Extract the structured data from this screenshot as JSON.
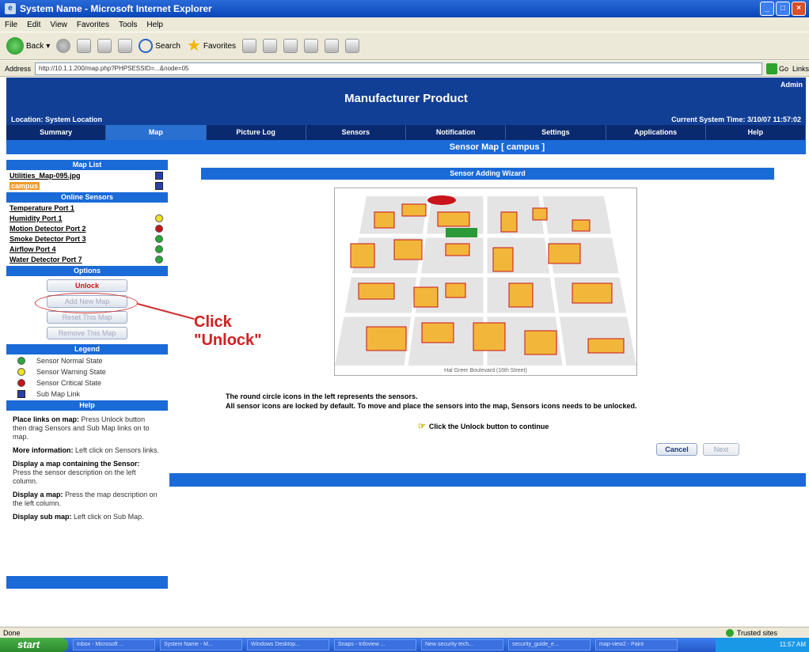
{
  "window": {
    "title": "System Name - Microsoft Internet Explorer"
  },
  "menu": [
    "File",
    "Edit",
    "View",
    "Favorites",
    "Tools",
    "Help"
  ],
  "toolbar": {
    "back_label": "Back",
    "search_label": "Search",
    "favorites_label": "Favorites"
  },
  "address": {
    "label": "Address",
    "url": "http://10.1.1.200/map.php?PHPSESSID=...&node=05",
    "go_label": "Go",
    "links_label": "Links"
  },
  "header": {
    "product": "Manufacturer Product",
    "user": "Admin",
    "location": "Location: System Location",
    "system_time": "Current System Time: 3/10/07 11:57:02"
  },
  "nav": [
    "Summary",
    "Map",
    "Picture Log",
    "Sensors",
    "Notification",
    "Settings",
    "Applications",
    "Help"
  ],
  "page_subtitle": "Sensor Map [ campus ]",
  "sidebar": {
    "map_list_title": "Map List",
    "maps": [
      "Utilities_Map-095.jpg",
      "campus"
    ],
    "online_sensors_title": "Online Sensors",
    "sensors": [
      {
        "label": "Temperature Port 1",
        "status": "none"
      },
      {
        "label": "Humidity Port 1",
        "status": "warning"
      },
      {
        "label": "Motion Detector Port 2",
        "status": "critical"
      },
      {
        "label": "Smoke Detector Port 3",
        "status": "normal"
      },
      {
        "label": "Airflow Port 4",
        "status": "normal"
      },
      {
        "label": "Water Detector Port 7",
        "status": "normal"
      }
    ],
    "options_title": "Options",
    "options": [
      "Unlock",
      "Add New Map",
      "Reset This Map",
      "Remove This Map"
    ],
    "legend_title": "Legend",
    "legend": [
      "Sensor Normal State",
      "Sensor Warning State",
      "Sensor Critical State",
      "Sub Map Link"
    ],
    "help_title": "Help",
    "help": [
      {
        "bold": "Place links on map:",
        "text": " Press Unlock button then drag Sensors and Sub Map links on to map."
      },
      {
        "bold": "More information:",
        "text": " Left click on Sensors links."
      },
      {
        "bold": "Display a map containing the Sensor:",
        "text": " Press the sensor description on the left column."
      },
      {
        "bold": "Display a map:",
        "text": " Press the map description on the left column."
      },
      {
        "bold": "Display sub map:",
        "text": " Left click on Sub Map."
      }
    ]
  },
  "callout": {
    "line1": "Click",
    "line2": "\"Unlock\""
  },
  "wizard": {
    "title": "Sensor Adding Wizard",
    "map_caption": "Hal Greer Boulevard (16th Street)",
    "text1": "The round circle icons in the left represents the sensors.",
    "text2": "All sensor icons are locked by default. To move and place the sensors into the map, Sensors icons needs to be unlocked.",
    "hint": "Click the Unlock button to continue",
    "cancel": "Cancel",
    "next": "Next"
  },
  "status": {
    "left": "Done",
    "zone": "Trusted sites"
  },
  "taskbar": {
    "start": "start",
    "items": [
      "Inbox - Microsoft ...",
      "System Name - M...",
      "Windows Desktop...",
      "Snaps - Infoview ...",
      "New security tech...",
      "security_guide_e...",
      "map-view2 - Paint"
    ],
    "clock": "11:57 AM"
  },
  "colors": {
    "header": "#123f96",
    "nav": "#0a2a70",
    "accent": "#1a6ad8",
    "callout": "#d02020",
    "normal": "#28a838",
    "warning": "#f0e020",
    "critical": "#c8141a",
    "submap": "#2b3fa8"
  }
}
